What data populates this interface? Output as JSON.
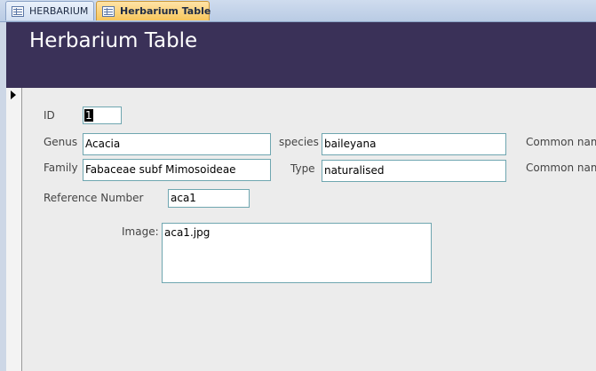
{
  "tabs": [
    {
      "label": "HERBARIUM"
    },
    {
      "label": "Herbarium Table"
    }
  ],
  "header": {
    "title": "Herbarium Table"
  },
  "form": {
    "id": {
      "label": "ID",
      "value": "1"
    },
    "genus": {
      "label": "Genus",
      "value": "Acacia"
    },
    "species": {
      "label": "species",
      "value": "baileyana"
    },
    "family": {
      "label": "Family",
      "value": "Fabaceae subf Mimosoideae"
    },
    "type": {
      "label": "Type",
      "value": "naturalised"
    },
    "common_name_1": {
      "label": "Common nam"
    },
    "common_name_2": {
      "label": "Common nam"
    },
    "reference_number": {
      "label": "Reference Number",
      "value": "aca1"
    },
    "image": {
      "label": "Image:",
      "value": "aca1.jpg"
    }
  },
  "icons": {
    "tab_icon": "table-form-icon",
    "record_selector": "current-record-arrow-icon"
  }
}
